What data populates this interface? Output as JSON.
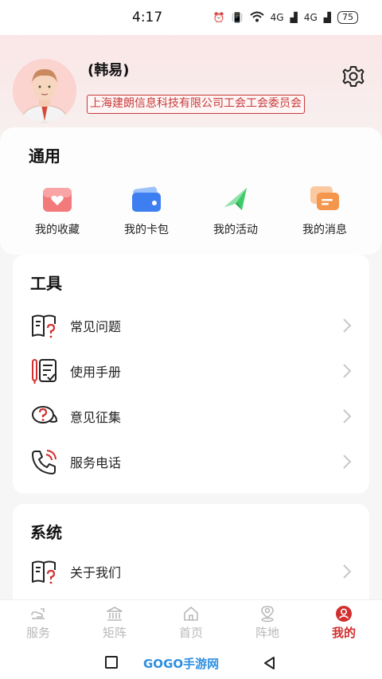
{
  "status_bar": {
    "time": "4:17",
    "signal_1": "4G",
    "signal_2": "4G",
    "battery": "75"
  },
  "profile": {
    "name": "(韩易)",
    "organization": "上海建朗信息科技有限公司工会工会委员会",
    "settings_icon": "gear-icon"
  },
  "general": {
    "title": "通用",
    "items": [
      {
        "label": "我的收藏",
        "icon": "heart-folder-icon"
      },
      {
        "label": "我的卡包",
        "icon": "wallet-icon"
      },
      {
        "label": "我的活动",
        "icon": "flag-icon"
      },
      {
        "label": "我的消息",
        "icon": "chat-icon"
      }
    ]
  },
  "tools": {
    "title": "工具",
    "items": [
      {
        "label": "常见问题",
        "icon": "faq-book-icon"
      },
      {
        "label": "使用手册",
        "icon": "manual-icon"
      },
      {
        "label": "意见征集",
        "icon": "feedback-bubble-icon"
      },
      {
        "label": "服务电话",
        "icon": "phone-icon"
      }
    ]
  },
  "system": {
    "title": "系统",
    "items": [
      {
        "label": "关于我们",
        "icon": "about-book-icon"
      }
    ]
  },
  "tabbar": {
    "tabs": [
      {
        "label": "服务",
        "icon": "service-icon"
      },
      {
        "label": "矩阵",
        "icon": "bank-icon"
      },
      {
        "label": "首页",
        "icon": "home-icon"
      },
      {
        "label": "阵地",
        "icon": "location-icon"
      },
      {
        "label": "我的",
        "icon": "user-icon",
        "active": true
      }
    ]
  },
  "watermark": "GOGO手游网",
  "colors": {
    "accent": "#d12f2f",
    "badge_border": "#c73a3a"
  }
}
